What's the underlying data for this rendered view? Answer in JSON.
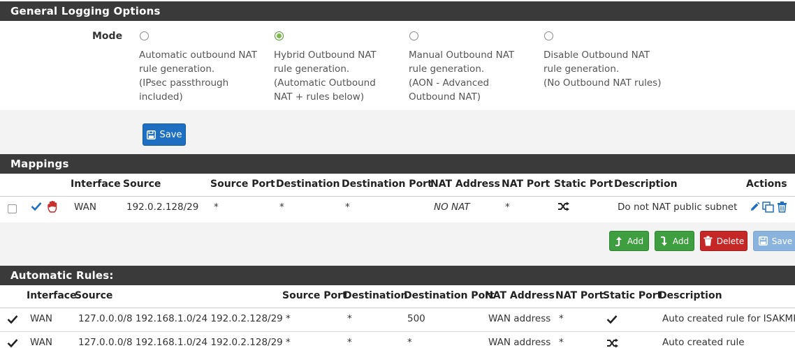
{
  "general": {
    "title": "General Logging Options",
    "mode_label": "Mode",
    "options": [
      {
        "lines": [
          "Automatic outbound NAT",
          "rule generation.",
          "(IPsec passthrough",
          "included)"
        ],
        "checked": false
      },
      {
        "lines": [
          "Hybrid Outbound NAT",
          "rule generation.",
          "(Automatic Outbound",
          "NAT + rules below)"
        ],
        "checked": true
      },
      {
        "lines": [
          "Manual Outbound NAT",
          "rule generation.",
          "(AON - Advanced",
          "Outbound NAT)"
        ],
        "checked": false
      },
      {
        "lines": [
          "Disable Outbound NAT",
          "rule generation.",
          "(No Outbound NAT rules)"
        ],
        "checked": false
      }
    ],
    "save_label": "Save"
  },
  "mappings": {
    "title": "Mappings",
    "headers": {
      "interface": "Interface",
      "source": "Source",
      "source_port": "Source Port",
      "destination": "Destination",
      "destination_port": "Destination Port",
      "nat_address": "NAT Address",
      "nat_port": "NAT Port",
      "static_port": "Static Port",
      "description": "Description",
      "actions": "Actions"
    },
    "row": {
      "interface": "WAN",
      "source": "192.0.2.128/29",
      "source_port": "*",
      "destination": "*",
      "destination_port": "*",
      "nat_address": "NO NAT",
      "nat_port": "*",
      "description": "Do not NAT public subnet"
    },
    "buttons": {
      "add_top": "Add",
      "add_bottom": "Add",
      "delete": "Delete",
      "save": "Save"
    }
  },
  "auto": {
    "title": "Automatic Rules:",
    "headers": {
      "interface": "Interface",
      "source": "Source",
      "source_port": "Source Port",
      "destination": "Destination",
      "destination_port": "Destination Port",
      "nat_address": "NAT Address",
      "nat_port": "NAT Port",
      "static_port": "Static Port",
      "description": "Description"
    },
    "rows": [
      {
        "interface": "WAN",
        "source": "127.0.0.0/8 192.168.1.0/24 192.0.2.128/29",
        "source_port": "*",
        "destination": "*",
        "destination_port": "500",
        "nat_address": "WAN address",
        "nat_port": "*",
        "description": "Auto created rule for ISAKMP"
      },
      {
        "interface": "WAN",
        "source": "127.0.0.0/8 192.168.1.0/24 192.0.2.128/29",
        "source_port": "*",
        "destination": "*",
        "destination_port": "*",
        "nat_address": "WAN address",
        "nat_port": "*",
        "description": "Auto created rule"
      }
    ]
  },
  "colors": {
    "accent_blue": "#1e6fc2",
    "green": "#3f9e3f",
    "red": "#c52727",
    "header_bg": "#3a3a3a"
  }
}
